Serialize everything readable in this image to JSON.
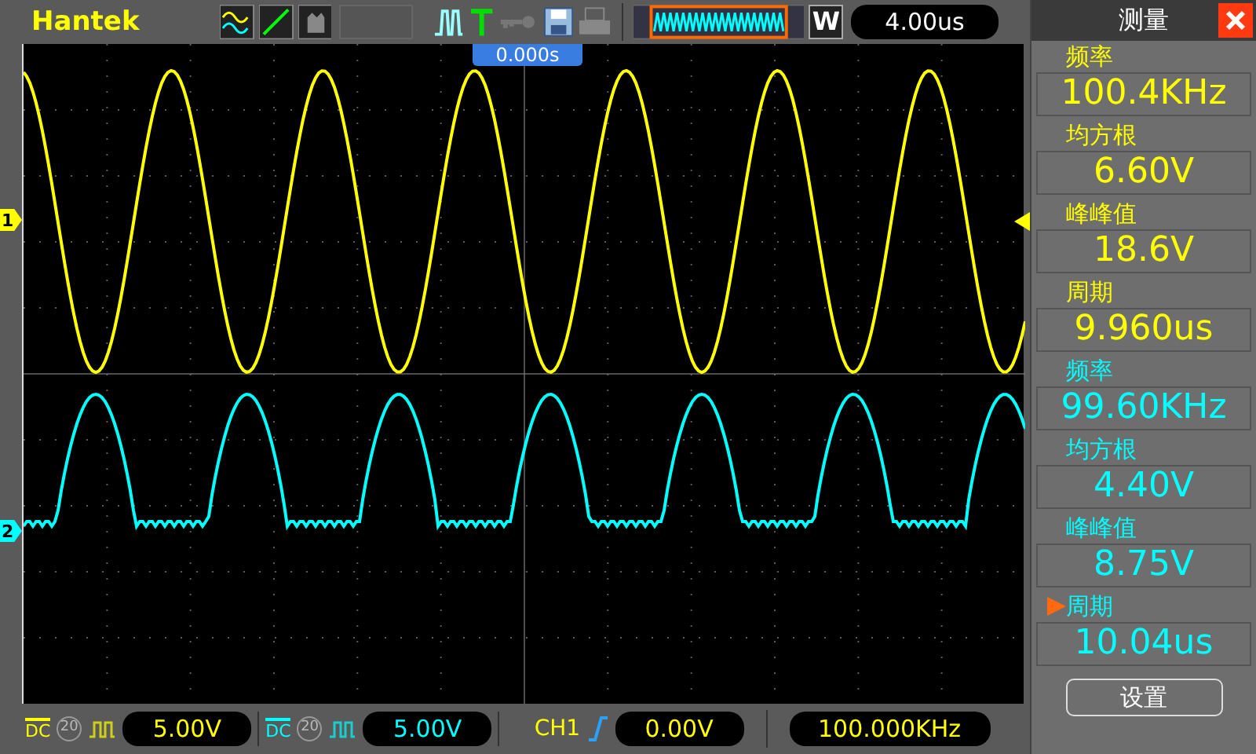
{
  "top_bar": {
    "brand": "Hantek",
    "mode_label": "W",
    "timebase": "4.00us",
    "trigger_position": "0.000s"
  },
  "channels": [
    {
      "marker": "1",
      "color": "#ffff00",
      "coupling": "DC",
      "bandwidth": "20",
      "scale": "5.00V"
    },
    {
      "marker": "2",
      "color": "#00ffff",
      "coupling": "DC",
      "bandwidth": "20",
      "scale": "5.00V"
    }
  ],
  "trigger": {
    "source": "CH1",
    "level": "0.00V",
    "frequency": "100.000KHz"
  },
  "measure_panel": {
    "title": "测量",
    "settings_button": "设置",
    "items": [
      {
        "label": "频率",
        "value": "100.4KHz",
        "color": "#ffff00",
        "selected": false
      },
      {
        "label": "均方根",
        "value": "6.60V",
        "color": "#ffff00",
        "selected": false
      },
      {
        "label": "峰峰值",
        "value": "18.6V",
        "color": "#ffff00",
        "selected": false
      },
      {
        "label": "周期",
        "value": "9.960us",
        "color": "#ffff00",
        "selected": false
      },
      {
        "label": "频率",
        "value": "99.60KHz",
        "color": "#00ffff",
        "selected": false
      },
      {
        "label": "均方根",
        "value": "4.40V",
        "color": "#00ffff",
        "selected": false
      },
      {
        "label": "峰峰值",
        "value": "8.75V",
        "color": "#00ffff",
        "selected": false
      },
      {
        "label": "周期",
        "value": "10.04us",
        "color": "#00ffff",
        "selected": true
      }
    ]
  }
}
